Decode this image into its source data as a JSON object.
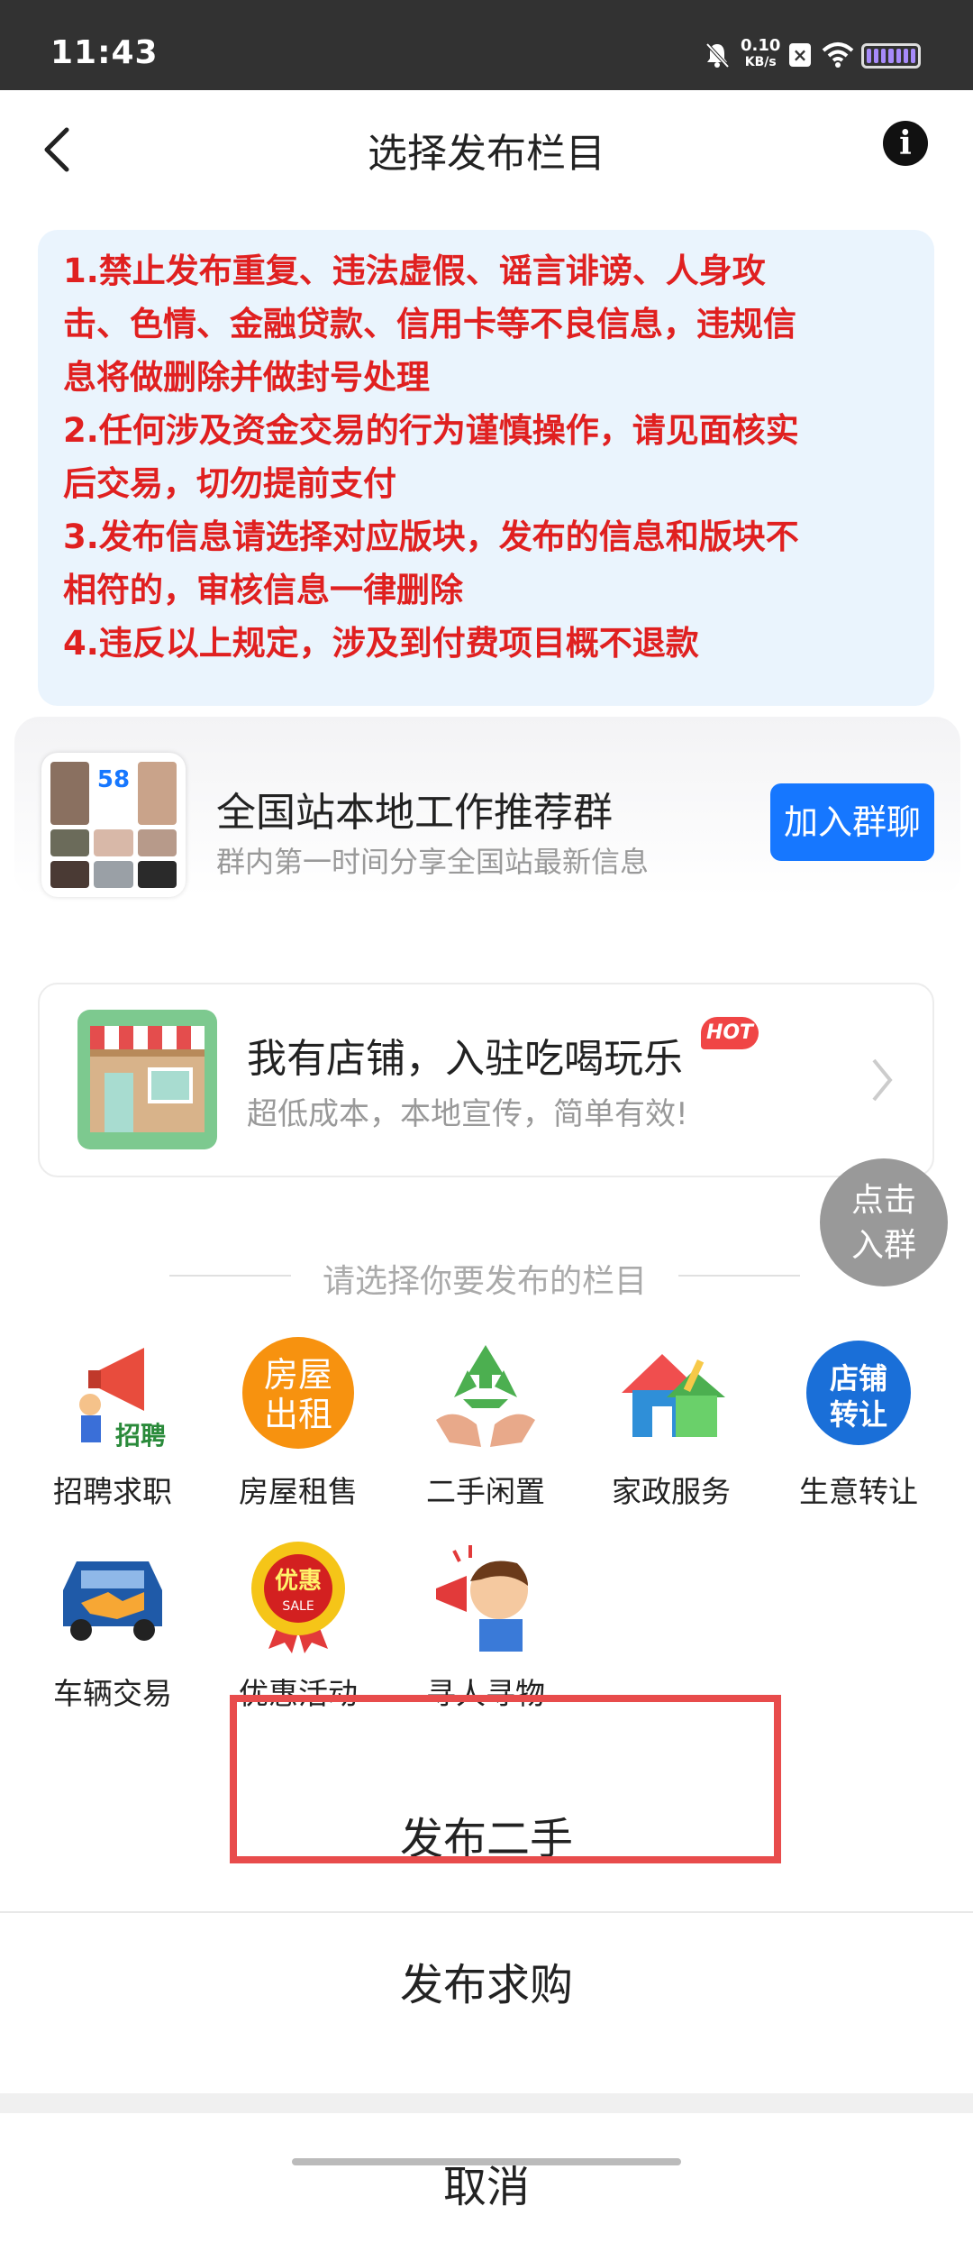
{
  "status_bar": {
    "time": "11:43",
    "net_speed_value": "0.10",
    "net_speed_unit": "KB/s"
  },
  "header": {
    "title": "选择发布栏目"
  },
  "rules": [
    "1.禁止发布重复、违法虚假、谣言诽谤、人身攻",
    "击、色情、金融贷款、信用卡等不良信息，违规信",
    "息将做删除并做封号处理",
    "2.任何涉及资金交易的行为谨慎操作，请见面核实",
    "后交易，切勿提前支付",
    "3.发布信息请选择对应版块，发布的信息和版块不",
    "相符的，审核信息一律删除",
    "4.违反以上规定，涉及到付费项目概不退款"
  ],
  "group": {
    "avatar_badge": "58",
    "name": "全国站本地工作推荐群",
    "desc": "群内第一时间分享全国站最新信息",
    "join_label": "加入群聊"
  },
  "shop": {
    "title": "我有店铺，入驻吃喝玩乐",
    "badge": "HOT",
    "subtitle": "超低成本，本地宣传，简单有效!"
  },
  "float_button": {
    "line1": "点击",
    "line2": "入群"
  },
  "section_title": "请选择你要发布的栏目",
  "categories": [
    {
      "label": "招聘求职",
      "icon": "megaphone-recruit-icon",
      "icon_text": "招聘"
    },
    {
      "label": "房屋租售",
      "icon": "house-rent-icon",
      "icon_text_1": "房屋",
      "icon_text_2": "出租"
    },
    {
      "label": "二手闲置",
      "icon": "recycle-hands-icon"
    },
    {
      "label": "家政服务",
      "icon": "house-cleaning-icon"
    },
    {
      "label": "生意转让",
      "icon": "shop-transfer-icon",
      "icon_text_1": "店铺",
      "icon_text_2": "转让"
    },
    {
      "label": "车辆交易",
      "icon": "car-handshake-icon"
    },
    {
      "label": "优惠活动",
      "icon": "sale-badge-icon",
      "icon_text_1": "优惠",
      "icon_text_2": "SALE"
    },
    {
      "label": "寻人寻物",
      "icon": "person-megaphone-icon"
    }
  ],
  "sheet": {
    "option1": "发布二手",
    "option2": "发布求购",
    "cancel": "取消"
  },
  "colors": {
    "rule_text": "#e02020",
    "rules_bg": "#eaf4fd",
    "join_button": "#1677ff",
    "highlight_border": "#e84c4c"
  }
}
